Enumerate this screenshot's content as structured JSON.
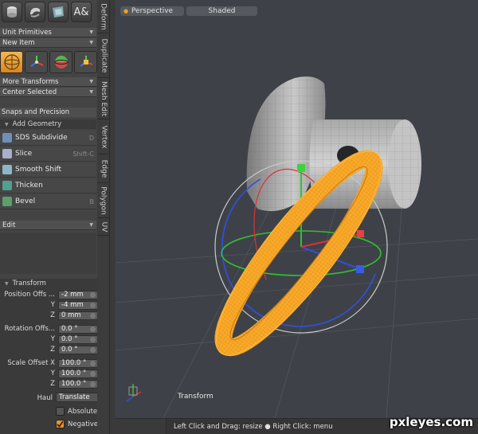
{
  "sidebar": {
    "top_icons": [
      "cube-icon",
      "sphere-icon",
      "cloth-icon",
      "text-icon"
    ],
    "text_icon_glyph": "A&",
    "primitive_dropdown": "Unit Primitives",
    "item_dropdown": "New Item",
    "tool_icons": [
      "select-tool-icon",
      "axis-tool-icon",
      "sculpt-tool-icon",
      "pivot-tool-icon"
    ],
    "more_transforms": "More Transforms",
    "center_selected": "Center Selected",
    "snaps": "Snaps and Precision",
    "add_geometry": "Add Geometry",
    "geometry_items": [
      {
        "label": "SDS Subdivide",
        "shortcut": "D"
      },
      {
        "label": "Slice",
        "shortcut": "Shift-C"
      },
      {
        "label": "Smooth Shift",
        "shortcut": ""
      },
      {
        "label": "Thicken",
        "shortcut": ""
      },
      {
        "label": "Bevel",
        "shortcut": "B"
      }
    ],
    "edit_dropdown": "Edit",
    "transform_header": "Transform",
    "position_label": "Position Offs ...",
    "position": {
      "x": "-2 mm",
      "y": "-4 mm",
      "z": "0 mm"
    },
    "rotation_label": "Rotation Offs...",
    "rotation": {
      "x": "0.0 °",
      "y": "0.0 °",
      "z": "0.0 °"
    },
    "scale_label": "Scale Offset X",
    "scale": {
      "x": "100.0 °",
      "y": "100.0 °",
      "z": "100.0 °"
    },
    "axis_y": "Y",
    "axis_z": "Z",
    "haul_label": "Haul",
    "haul_value": "Translate",
    "absolute_label": "Absolute ...",
    "negative_label": "Negative ...",
    "absolute_checked": false,
    "negative_checked": true
  },
  "vertical_tabs": [
    "Deform",
    "Duplicate",
    "Mesh Edit",
    "Vertex",
    "Edge",
    "Polygon",
    "UV"
  ],
  "viewport": {
    "view_mode": "Perspective",
    "shading": "Shaded",
    "tool_label": "Transform",
    "colors": {
      "background": "#3e4248",
      "ring": "#f3a01e",
      "x_axis": "#e03030",
      "y_axis": "#30c030",
      "z_axis": "#3050e0"
    }
  },
  "status_bar": {
    "hint": "Left Click and Drag: resize ● Right Click: menu"
  },
  "watermark": "pxleyes.com"
}
